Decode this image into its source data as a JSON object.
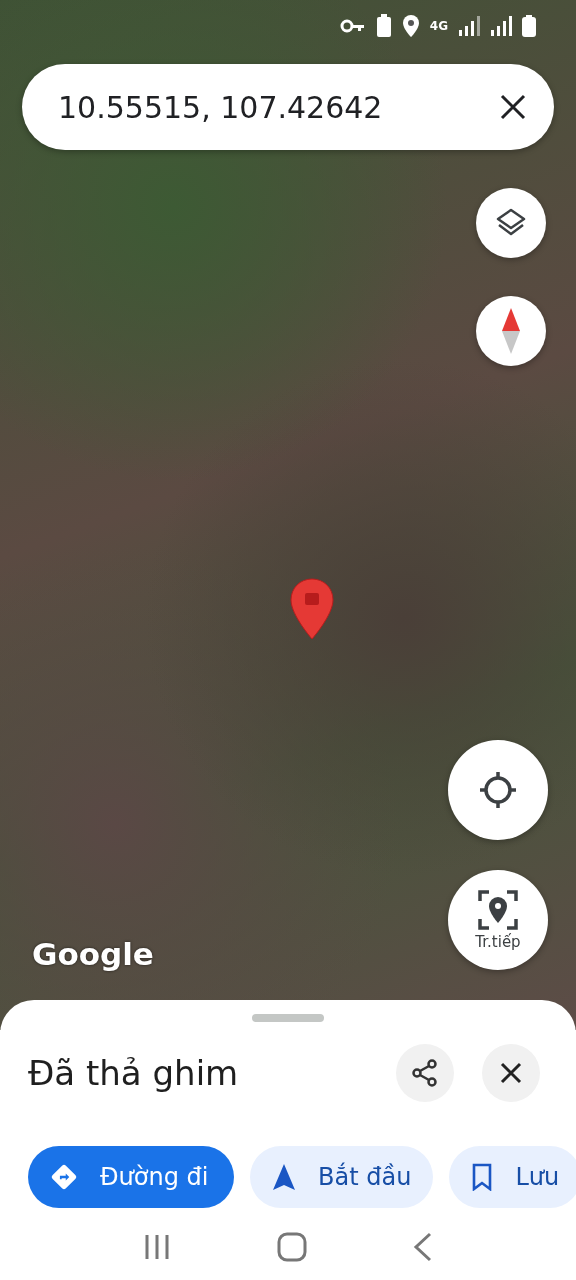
{
  "status_bar": {
    "network": "4G"
  },
  "search": {
    "value": "10.55515, 107.42642"
  },
  "map": {
    "logo": "Google"
  },
  "locate_button": {
    "label": "Tr.tiếp"
  },
  "sheet": {
    "title": "Đã thả ghim",
    "actions": [
      {
        "kind": "directions",
        "label": "Đường đi",
        "selected": true
      },
      {
        "kind": "start",
        "label": "Bắt đầu",
        "selected": false
      },
      {
        "kind": "save",
        "label": "Lưu",
        "selected": false
      }
    ]
  }
}
